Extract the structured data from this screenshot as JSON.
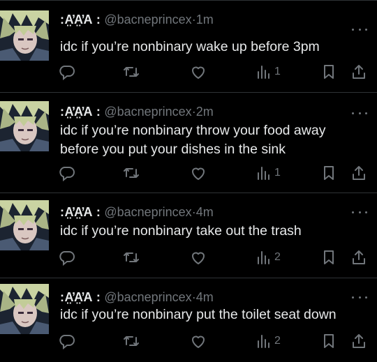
{
  "tweets": [
    {
      "name": ":A̤̓A̤̓A :",
      "handle": "@bacneprincex",
      "separator": "·",
      "time": "1m",
      "lines": [
        "idc if you’re nonbinary wake up before 3pm"
      ],
      "views": "1"
    },
    {
      "name": ":A̤̓A̤̓A :",
      "handle": "@bacneprincex",
      "separator": "·",
      "time": "2m",
      "lines": [
        "idc if you’re nonbinary throw your food away",
        "before you put your dishes in the sink"
      ],
      "views": "1"
    },
    {
      "name": ":A̤̓A̤̓A :",
      "handle": "@bacneprincex",
      "separator": "·",
      "time": "4m",
      "lines": [
        "idc if you’re nonbinary take out the trash"
      ],
      "views": "2"
    },
    {
      "name": ":A̤̓A̤̓A :",
      "handle": "@bacneprincex",
      "separator": "·",
      "time": "4m",
      "lines": [
        "idc if you’re nonbinary put the toilet seat down"
      ],
      "views": "2"
    }
  ],
  "icons": {
    "reply": "reply-icon",
    "retweet": "retweet-icon",
    "like": "heart-icon",
    "views": "views-icon",
    "bookmark": "bookmark-icon",
    "share": "share-icon",
    "more": "more-icon"
  },
  "colors": {
    "background": "#000000",
    "text": "#e7e9ea",
    "muted": "#71767b",
    "divider": "#2f3336"
  }
}
